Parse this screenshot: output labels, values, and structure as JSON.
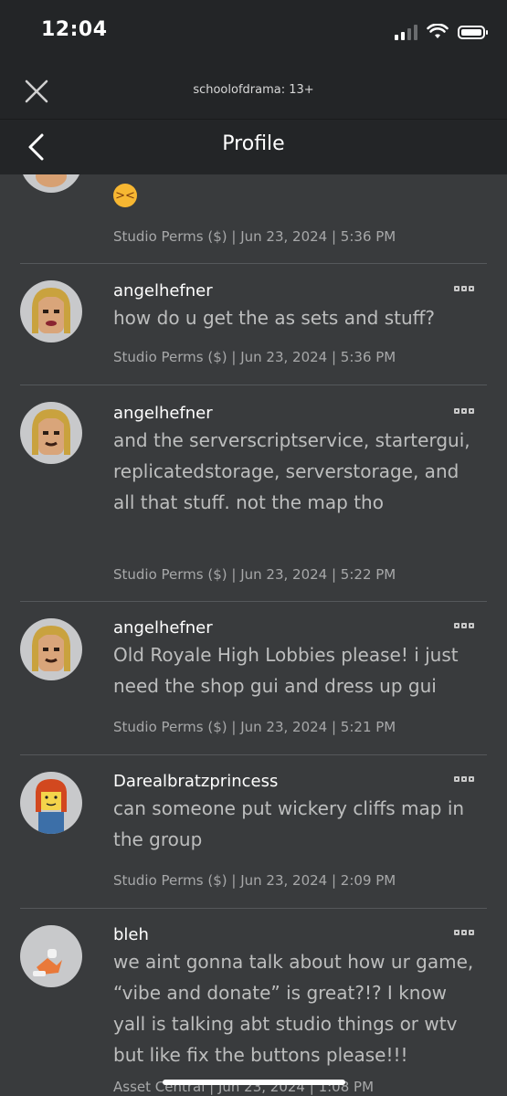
{
  "status_bar": {
    "time": "12:04"
  },
  "webview": {
    "title": "schoolofdrama: 13+"
  },
  "nav": {
    "title": "Profile"
  },
  "posts": [
    {
      "author": "",
      "message": "",
      "meta": "Studio Perms ($) | Jun 23, 2024 | 5:36 PM",
      "emoji": "persevering-face"
    },
    {
      "author": "angelhefner",
      "message": "how do u get the as sets and stuff?",
      "meta": "Studio Perms ($) | Jun 23, 2024 | 5:36 PM"
    },
    {
      "author": "angelhefner",
      "message": "and the serverscriptservice, startergui, replicatedstorage, serverstorage, and all that stuff. not the map tho",
      "meta": "Studio Perms ($) | Jun 23, 2024 | 5:22 PM"
    },
    {
      "author": "angelhefner",
      "message": "Old Royale High Lobbies please! i just need the shop gui and dress up gui",
      "meta": "Studio Perms ($) | Jun 23, 2024 | 5:21 PM"
    },
    {
      "author": "Darealbratzprincess",
      "message": "can someone put wickery cliffs map in the group",
      "meta": "Studio Perms ($) | Jun 23, 2024 | 2:09 PM"
    },
    {
      "author": "bleh",
      "message": "we aint gonna talk about how ur game, “vibe and donate” is great?!? I know yall is talking abt studio things or wtv but like fix the buttons please!!!",
      "meta": "Asset Central | Jun 23, 2024 | 1:08 PM"
    }
  ],
  "colors": {
    "background": "#393b3d",
    "header": "#232527",
    "text_secondary": "#bdbebe"
  }
}
